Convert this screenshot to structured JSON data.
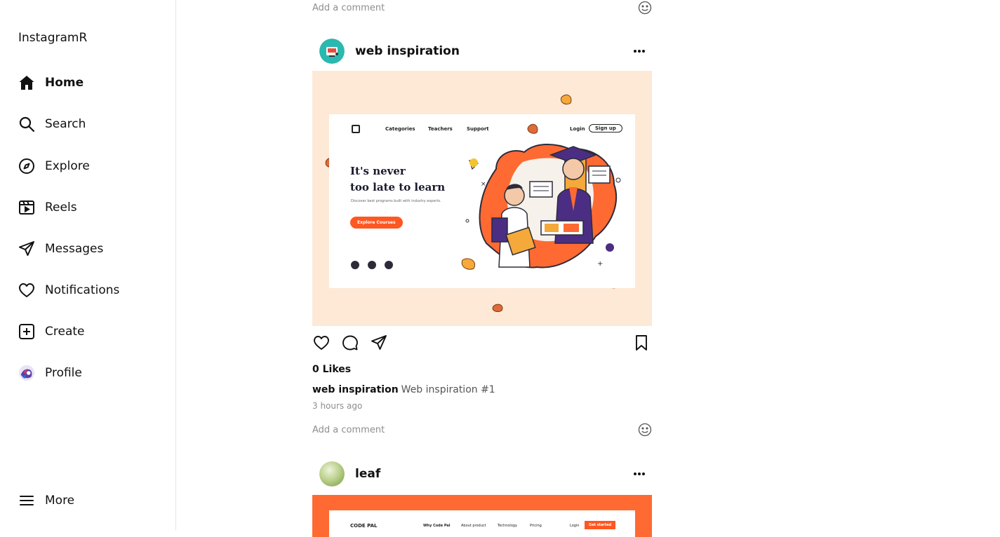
{
  "app": {
    "title": "InstagramR"
  },
  "sidebar": {
    "items": [
      {
        "label": "Home",
        "icon": "home-icon"
      },
      {
        "label": "Search",
        "icon": "search-icon"
      },
      {
        "label": "Explore",
        "icon": "compass-icon"
      },
      {
        "label": "Reels",
        "icon": "reels-icon"
      },
      {
        "label": "Messages",
        "icon": "send-icon"
      },
      {
        "label": "Notifications",
        "icon": "heart-icon"
      },
      {
        "label": "Create",
        "icon": "plus-square-icon"
      },
      {
        "label": "Profile",
        "icon": "profile-avatar"
      }
    ],
    "more": {
      "label": "More",
      "icon": "menu-icon"
    }
  },
  "feed": {
    "top_comment_placeholder": "Add a comment",
    "posts": [
      {
        "user": "web inspiration",
        "likes": "0 Likes",
        "caption_user": "web inspiration",
        "caption_text": "Web inspiration #1",
        "time": "3 hours ago",
        "comment_placeholder": "Add a comment",
        "image": {
          "nav": [
            "Categories",
            "Teachers",
            "Support"
          ],
          "login": "Login",
          "signup": "Sign up",
          "headline_1": "It's never",
          "headline_2": "too late to learn",
          "subtext": "Discover best programs built with industry experts.",
          "cta": "Explore Courses"
        }
      },
      {
        "user": "leaf",
        "image": {
          "brand": "CODE PAL",
          "nav": [
            "Why Code Pal",
            "About product",
            "Technology",
            "Pricing"
          ],
          "login": "Login",
          "cta": "Get started"
        }
      }
    ]
  },
  "colors": {
    "accent_orange": "#ff5722",
    "post_bg_peach": "#fde9d6",
    "post2_bg": "#ff6a33"
  }
}
